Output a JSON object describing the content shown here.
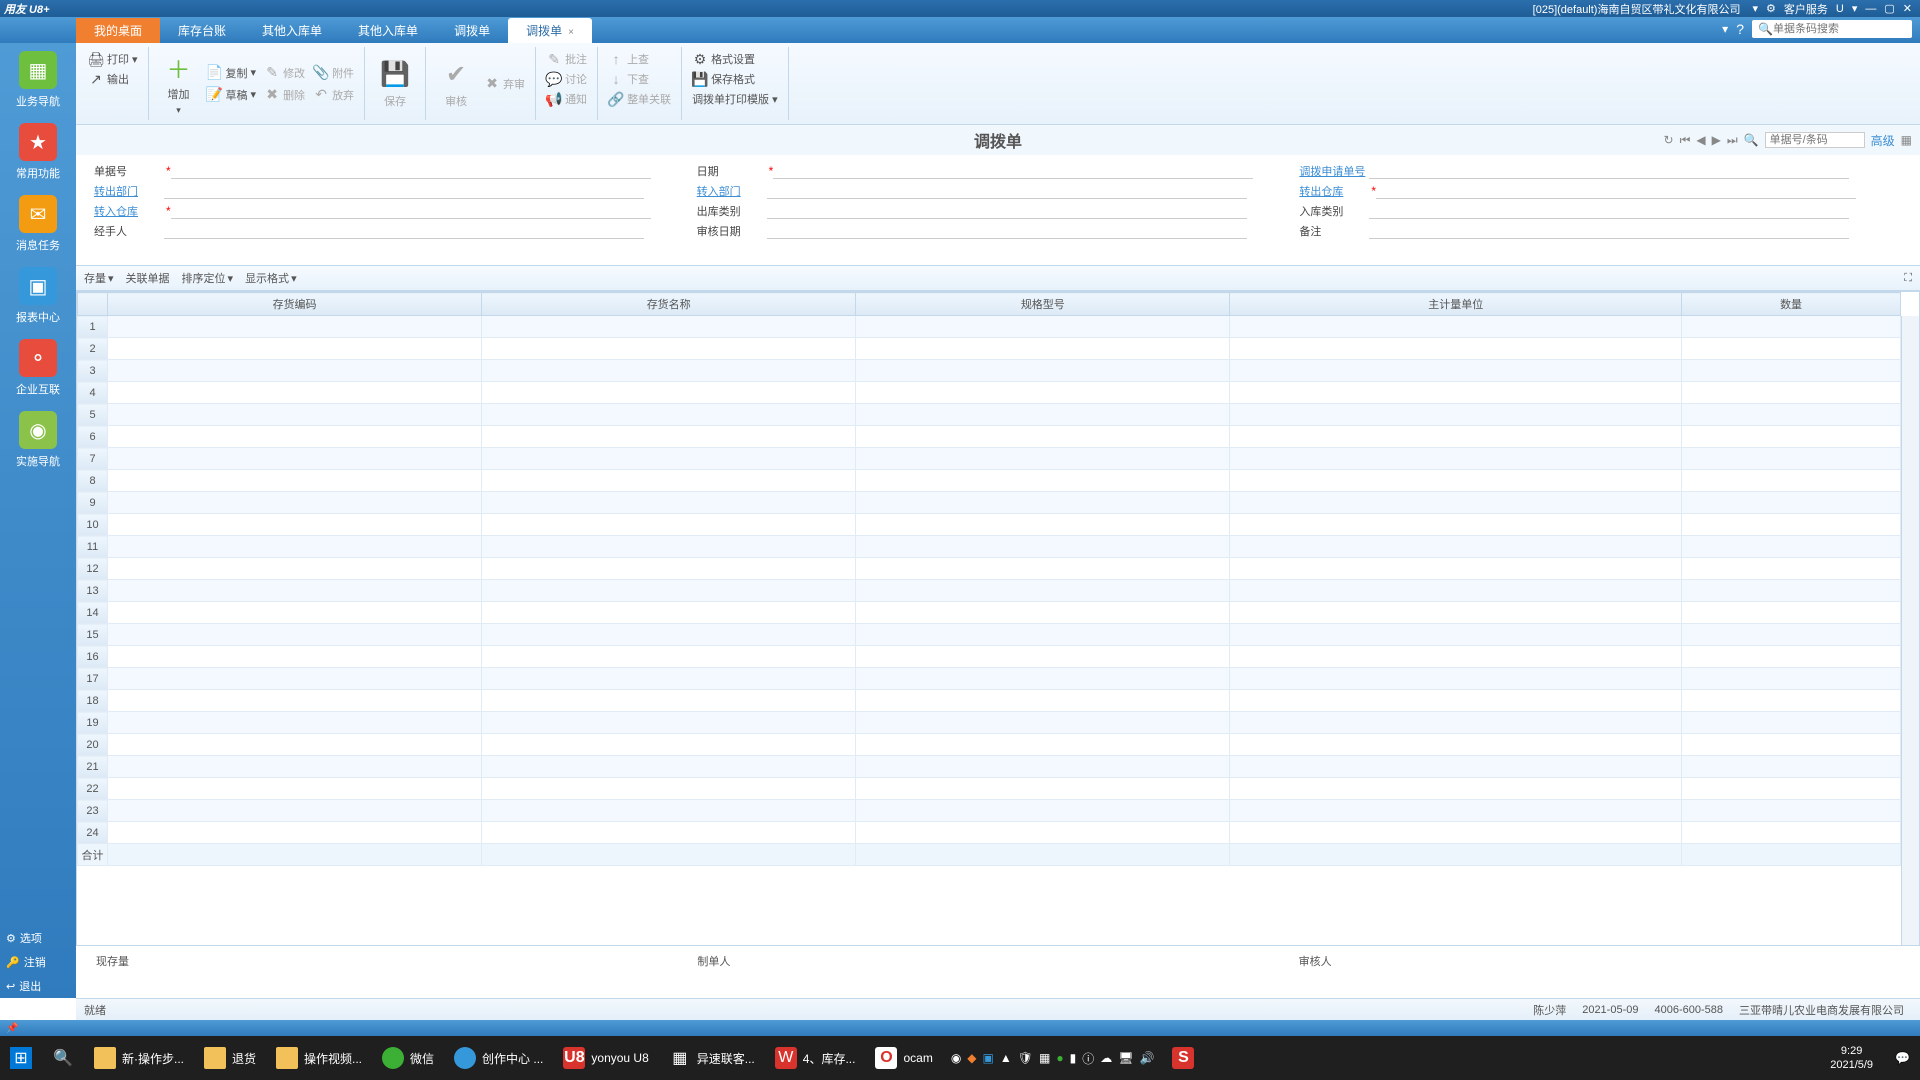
{
  "titlebar": {
    "brand": "用友 U8+",
    "org_info": "[025](default)海南自贸区带礼文化有限公司",
    "customer_service": "客户服务",
    "u_menu": "U"
  },
  "header": {
    "search_placeholder": "单据条码搜索"
  },
  "tabs": [
    {
      "label": "我的桌面",
      "home": true
    },
    {
      "label": "库存台账"
    },
    {
      "label": "其他入库单"
    },
    {
      "label": "其他入库单"
    },
    {
      "label": "调拨单"
    },
    {
      "label": "调拨单",
      "active": true
    }
  ],
  "leftnav": {
    "items": [
      {
        "label": "业务导航",
        "color": "green",
        "icon": "▦"
      },
      {
        "label": "常用功能",
        "color": "red",
        "icon": "★"
      },
      {
        "label": "消息任务",
        "color": "orange",
        "icon": "✉"
      },
      {
        "label": "报表中心",
        "color": "blue",
        "icon": "▣"
      },
      {
        "label": "企业互联",
        "color": "red",
        "icon": "⚬"
      },
      {
        "label": "实施导航",
        "color": "lime",
        "icon": "◉"
      }
    ],
    "bottom": [
      {
        "label": "选项",
        "icon": "⚙"
      },
      {
        "label": "注销",
        "icon": "🔑"
      },
      {
        "label": "退出",
        "icon": "↩"
      }
    ]
  },
  "ribbon": {
    "print": "打印",
    "output": "输出",
    "add": "增加",
    "copy": "复制",
    "draft": "草稿",
    "modify": "修改",
    "delete": "删除",
    "attach": "附件",
    "giveup": "放弃",
    "save": "保存",
    "audit": "审核",
    "unaudit": "弃审",
    "note": "批注",
    "discuss": "讨论",
    "notify": "通知",
    "submit": "上查",
    "lookdown": "下查",
    "wholerel": "整单关联",
    "fmtset": "格式设置",
    "fmtsave": "保存格式",
    "printtpl": "调拨单打印模版"
  },
  "doc": {
    "title": "调拨单",
    "nav_search_placeholder": "单据号/条码",
    "advanced": "高级"
  },
  "form": {
    "doc_no": "单据号",
    "date": "日期",
    "req_no": "调拨申请单号",
    "out_dept": "转出部门",
    "in_dept": "转入部门",
    "out_wh": "转出仓库",
    "in_wh": "转入仓库",
    "out_type": "出库类别",
    "in_type": "入库类别",
    "handler": "经手人",
    "audit_date": "审核日期",
    "remark": "备注"
  },
  "subtoolbar": {
    "qty": "存量",
    "related": "关联单据",
    "sort": "排序定位",
    "dispfmt": "显示格式"
  },
  "grid": {
    "cols": [
      "存货编码",
      "存货名称",
      "规格型号",
      "主计量单位",
      "数量"
    ],
    "total_label": "合计",
    "row_count": 24
  },
  "footer_info": {
    "stock": "现存量",
    "maker": "制单人",
    "auditor": "审核人"
  },
  "statusbar": {
    "ready": "就绪",
    "user": "陈少萍",
    "date": "2021-05-09",
    "hotline": "4006-600-588",
    "company": "三亚带晴儿农业电商发展有限公司"
  },
  "taskbar": {
    "items": [
      {
        "label": "新·操作步...",
        "icon": "folder"
      },
      {
        "label": "退货",
        "icon": "folder"
      },
      {
        "label": "操作视频...",
        "icon": "folder"
      },
      {
        "label": "微信",
        "icon": "wechat"
      },
      {
        "label": "创作中心 ...",
        "icon": "blue360"
      },
      {
        "label": "yonyou U8",
        "icon": "u8"
      },
      {
        "label": "异速联客...",
        "icon": "generic"
      },
      {
        "label": "4、库存...",
        "icon": "wps"
      },
      {
        "label": "ocam",
        "icon": "ocam"
      }
    ],
    "time": "9:29",
    "date": "2021/5/9"
  }
}
